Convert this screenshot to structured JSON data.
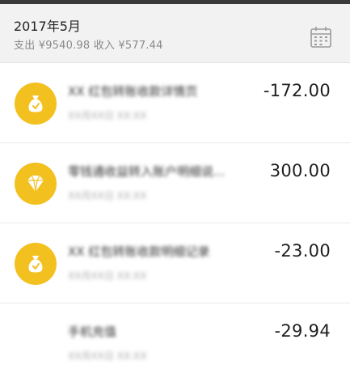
{
  "header": {
    "month": "2017年5月",
    "summary": "支出 ¥9540.98 收入 ¥577.44"
  },
  "transactions": [
    {
      "icon": "money-bag-icon",
      "title": "XX 红包转账收款详情页",
      "subtitle": "XX月XX日 XX:XX",
      "amount": "-172.00"
    },
    {
      "icon": "diamond-icon",
      "title": "零钱通收益转入账户明细说...",
      "subtitle": "XX月XX日 XX:XX",
      "amount": "300.00"
    },
    {
      "icon": "money-bag-icon",
      "title": "XX 红包转账收款明细记录",
      "subtitle": "XX月XX日 XX:XX",
      "amount": "-23.00"
    },
    {
      "icon": "",
      "title": "手机充值",
      "subtitle": "XX月XX日 XX:XX",
      "amount": "-29.94"
    }
  ],
  "colors": {
    "icon_background": "#f2c01f",
    "header_background": "#f2f2f2"
  }
}
